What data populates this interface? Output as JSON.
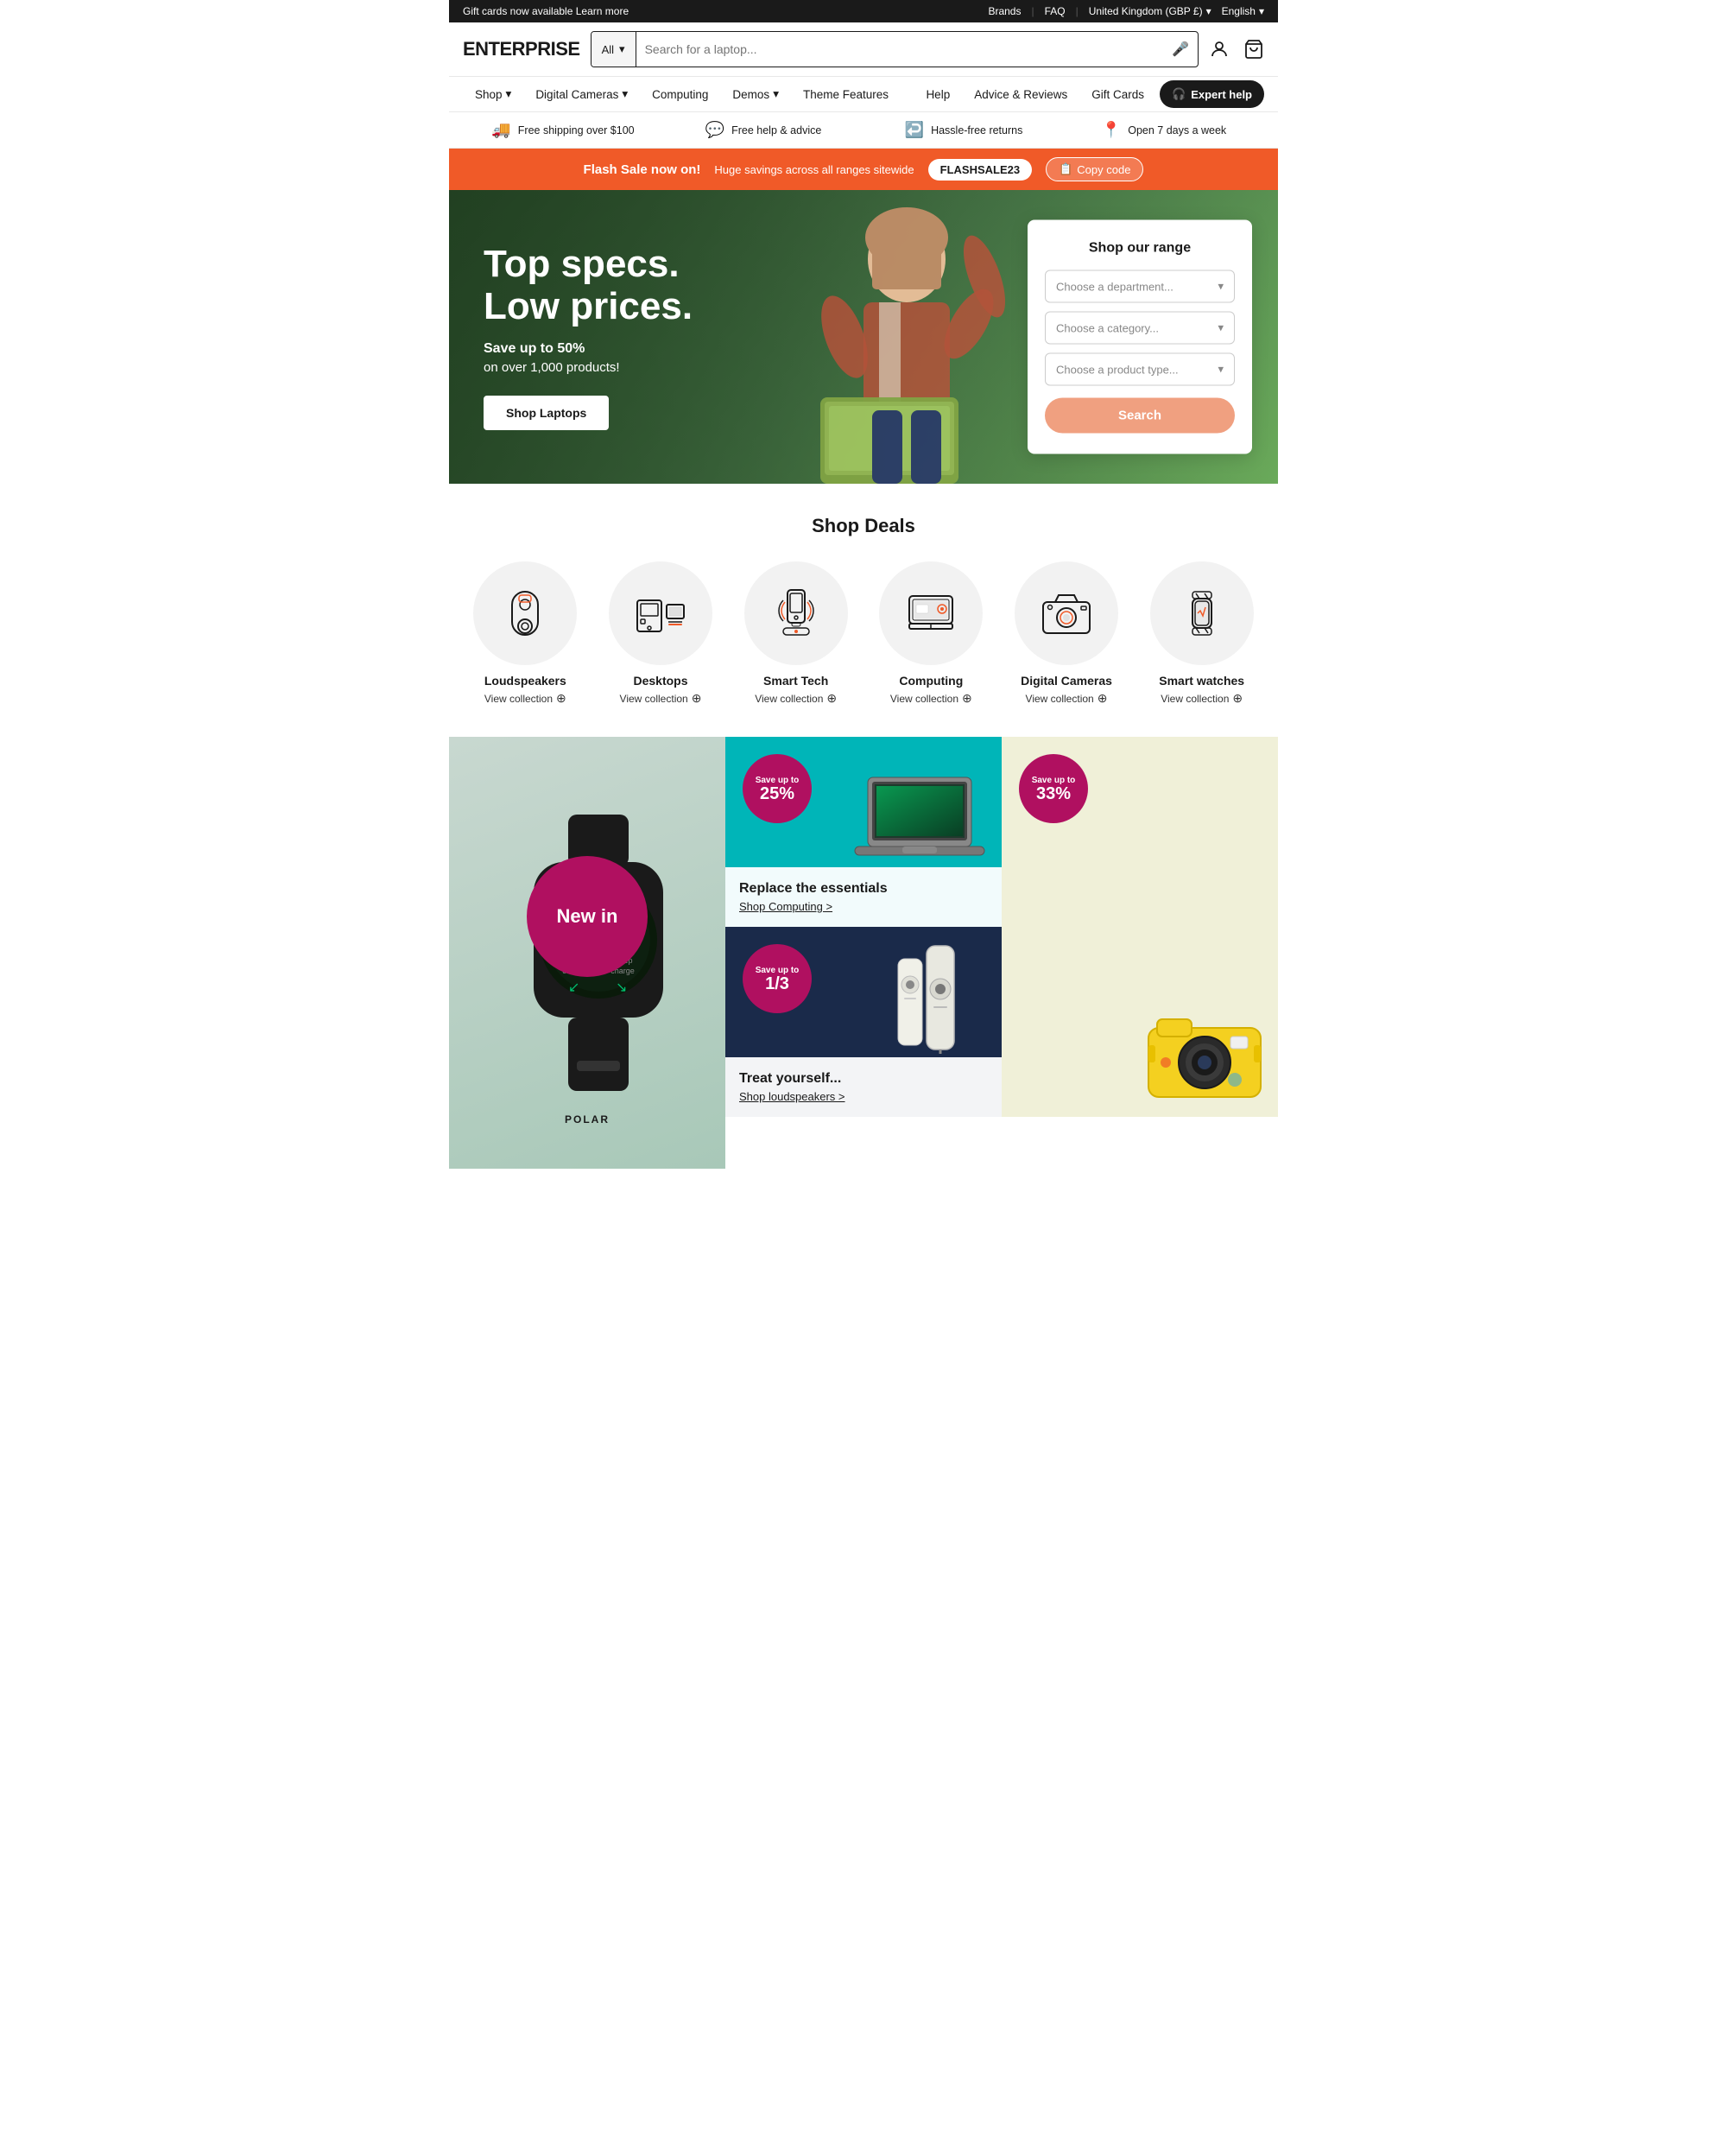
{
  "topbar": {
    "gift_text": "Gift cards now available",
    "learn_more": "Learn more",
    "brands": "Brands",
    "faq": "FAQ",
    "region": "United Kingdom (GBP £)",
    "language": "English"
  },
  "header": {
    "logo": "ENTERPRISE",
    "search_category": "All",
    "search_placeholder": "Search for a laptop..."
  },
  "nav": {
    "items": [
      {
        "label": "Shop",
        "has_dropdown": true
      },
      {
        "label": "Digital Cameras",
        "has_dropdown": true
      },
      {
        "label": "Computing",
        "has_dropdown": false
      },
      {
        "label": "Demos",
        "has_dropdown": true
      },
      {
        "label": "Theme Features",
        "has_dropdown": false
      }
    ],
    "right_items": [
      {
        "label": "Help"
      },
      {
        "label": "Advice & Reviews"
      },
      {
        "label": "Gift Cards"
      }
    ],
    "expert_btn": "Expert help"
  },
  "benefits": [
    {
      "icon": "🚚",
      "text": "Free shipping over $100"
    },
    {
      "icon": "💬",
      "text": "Free help & advice"
    },
    {
      "icon": "↩",
      "text": "Hassle-free returns"
    },
    {
      "icon": "📍",
      "text": "Open 7 days a week"
    }
  ],
  "flash_banner": {
    "title": "Flash Sale now on!",
    "desc": "Huge savings across all ranges sitewide",
    "code": "FLASHSALE23",
    "copy_label": "Copy code"
  },
  "hero": {
    "title_line1": "Top specs.",
    "title_line2": "Low prices.",
    "sub1": "Save up to 50%",
    "sub2": "on over 1,000 products!",
    "cta": "Shop Laptops",
    "range_panel": {
      "title": "Shop our range",
      "dept_placeholder": "Choose a department...",
      "cat_placeholder": "Choose a category...",
      "type_placeholder": "Choose a product type...",
      "search_label": "Search"
    }
  },
  "deals": {
    "section_title": "Shop Deals",
    "items": [
      {
        "name": "Loudspeakers",
        "link": "View collection",
        "icon_type": "speaker"
      },
      {
        "name": "Desktops",
        "link": "View collection",
        "icon_type": "desktop"
      },
      {
        "name": "Smart Tech",
        "link": "View collection",
        "icon_type": "smarttech"
      },
      {
        "name": "Computing",
        "link": "View collection",
        "icon_type": "computing"
      },
      {
        "name": "Digital Cameras",
        "link": "View collection",
        "icon_type": "camera"
      },
      {
        "name": "Smart watches",
        "link": "View collection",
        "icon_type": "watch"
      }
    ]
  },
  "promos": {
    "large": {
      "badge": "New in",
      "type": "watch"
    },
    "small": [
      {
        "badge_pre": "Save up to",
        "badge_val": "25%",
        "title": "Replace the essentials",
        "link": "Shop Computing >",
        "bg": "teal",
        "type": "laptop"
      },
      {
        "badge_pre": "Save up to",
        "badge_val": "1/3",
        "title": "Treat yourself...",
        "link": "Shop loudspeakers >",
        "bg": "navy",
        "type": "speaker"
      },
      {
        "badge_pre": "Save up to",
        "badge_val": "33%",
        "title": "",
        "link": "",
        "bg": "yellow",
        "type": "camera"
      }
    ]
  }
}
